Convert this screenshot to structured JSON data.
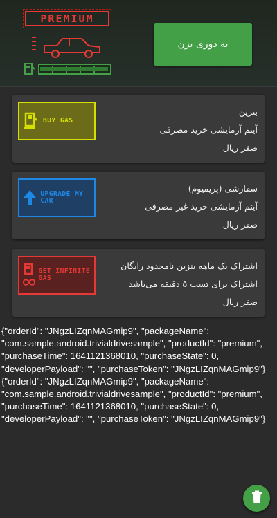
{
  "header": {
    "premium_label": "PREMIUM",
    "drive_button_label": "یه دوری بزن",
    "gas_level": 0.0
  },
  "products": [
    {
      "badge_text": "BUY GAS",
      "badge_color": "#d6e000",
      "badge_bg": "#6b6b1a",
      "title": "بنزین",
      "description": "آیتم آزمایشی خرید مصرفی",
      "price": "صفر ریال"
    },
    {
      "badge_text": "UPGRADE MY CAR",
      "badge_color": "#1e88e5",
      "badge_bg": "#1f3f64",
      "title": "سفارشی (پریمیوم)",
      "description": "آیتم آزمایشی خرید غیر مصرفی",
      "price": "صفر ریال"
    },
    {
      "badge_text": "GET INFINITE GAS",
      "badge_color": "#e53935",
      "badge_bg": "#5a2121",
      "title": "اشتراک یک ماهه بنزین نامحدود رایگان",
      "description": "اشتراک برای تست ۵ دقیقه می‌باشد",
      "price": "صفر ریال"
    }
  ],
  "log": [
    "{\"orderId\": \"JNgzLIZqnMAGmip9\", \"packageName\": \"com.sample.android.trivialdrivesample\", \"productId\": \"premium\", \"purchaseTime\": 1641121368010, \"purchaseState\": 0, \"developerPayload\": \"\", \"purchaseToken\": \"JNgzLIZqnMAGmip9\"}",
    "{\"orderId\": \"JNgzLIZqnMAGmip9\", \"packageName\": \"com.sample.android.trivialdrivesample\", \"productId\": \"premium\", \"purchaseTime\": 1641121368010, \"purchaseState\": 0, \"developerPayload\": \"\", \"purchaseToken\": \"JNgzLIZqnMAGmip9\"}"
  ],
  "icons": {
    "car": "car-icon",
    "gas_pump": "gas-pump-icon",
    "arrow_up": "arrow-up-icon",
    "infinity": "infinity-icon",
    "trash": "trash-icon"
  },
  "colors": {
    "accent_green": "#43a047",
    "premium_red": "#e53935"
  }
}
